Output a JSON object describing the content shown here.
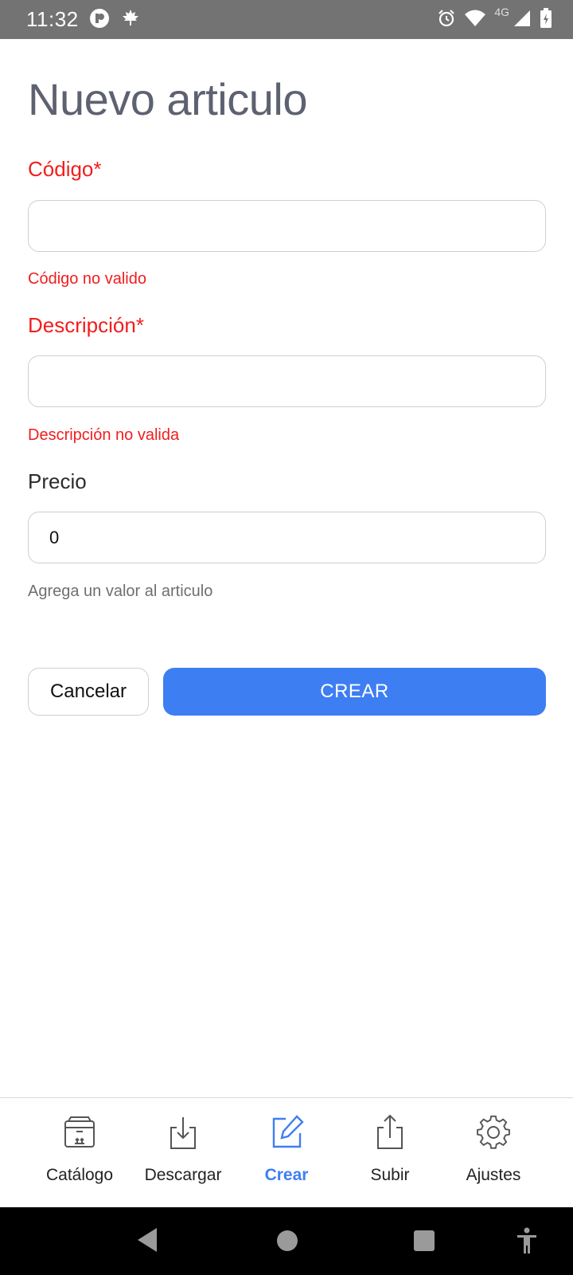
{
  "status_bar": {
    "time": "11:32",
    "network": "4G",
    "icons": [
      "app-notification-icon",
      "maple-leaf-icon",
      "alarm-icon",
      "wifi-icon",
      "signal-icon",
      "battery-icon"
    ]
  },
  "page": {
    "title": "Nuevo articulo"
  },
  "form": {
    "codigo": {
      "label": "Código*",
      "value": "",
      "error": "Código no valido"
    },
    "descripcion": {
      "label": "Descripción*",
      "value": "",
      "error": "Descripción no valida"
    },
    "precio": {
      "label": "Precio",
      "value": "0",
      "helper": "Agrega un valor al articulo"
    }
  },
  "actions": {
    "cancel_label": "Cancelar",
    "create_label": "CREAR"
  },
  "bottom_nav": {
    "items": [
      {
        "label": "Catálogo",
        "icon": "box-icon",
        "active": false
      },
      {
        "label": "Descargar",
        "icon": "download-icon",
        "active": false
      },
      {
        "label": "Crear",
        "icon": "edit-icon",
        "active": true
      },
      {
        "label": "Subir",
        "icon": "upload-icon",
        "active": false
      },
      {
        "label": "Ajustes",
        "icon": "gear-icon",
        "active": false
      }
    ]
  },
  "colors": {
    "accent": "#3e7ef3",
    "error": "#f21d1d",
    "title": "#5e6170"
  }
}
